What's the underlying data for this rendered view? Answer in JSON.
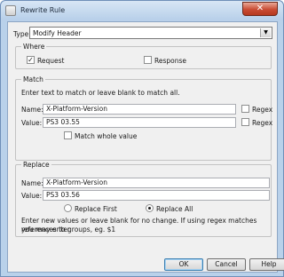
{
  "window": {
    "title": "Rewrite Rule",
    "close_glyph": "✕"
  },
  "type": {
    "label": "Type:",
    "selected": "Modify Header"
  },
  "where": {
    "title": "Where",
    "request": {
      "label": "Request",
      "checked": true
    },
    "response": {
      "label": "Response",
      "checked": false
    }
  },
  "match": {
    "title": "Match",
    "instructions": "Enter text to match or leave blank to match all.",
    "name_label": "Name:",
    "name_value": "X-Platform-Version",
    "name_regex_label": "Regex",
    "value_label": "Value:",
    "value_value": "PS3 03.55",
    "value_regex_label": "Regex",
    "match_whole_label": "Match whole value"
  },
  "replace": {
    "title": "Replace",
    "name_label": "Name:",
    "name_value": "X-Platform-Version",
    "value_label": "Value:",
    "value_value": "PS3 03.56",
    "replace_first_label": "Replace First",
    "replace_all_label": "Replace All",
    "selected_mode": "Replace All",
    "note_line1": "Enter new values or leave blank for no change. If using regex matches you may enter",
    "note_line2": "references to groups, eg. $1"
  },
  "buttons": {
    "ok": "OK",
    "cancel": "Cancel",
    "help": "Help"
  },
  "checkmark": "✓"
}
